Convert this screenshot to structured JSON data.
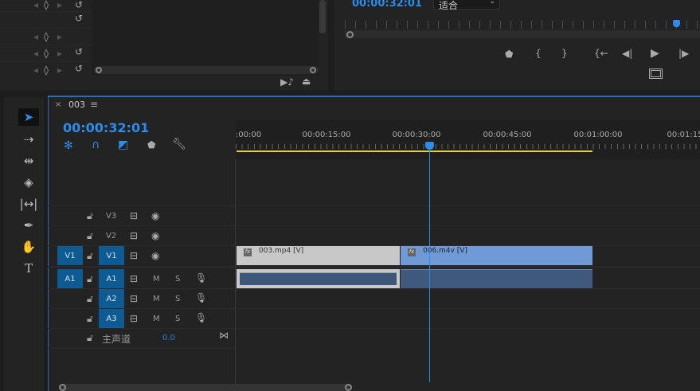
{
  "effect_controls": {
    "rows": [
      {
        "reset": true
      },
      {
        "reset": true
      },
      {
        "reset": false
      },
      {
        "reset": true
      },
      {
        "reset": true
      }
    ]
  },
  "program_monitor": {
    "timecode": "00:00:32:01",
    "fit_select": "适合",
    "playhead_fraction": 0.94,
    "controls": [
      "marker-icon",
      "mark-in-icon",
      "mark-out-icon",
      "go-to-in-icon",
      "step-back-icon",
      "play-icon",
      "step-forward-icon"
    ]
  },
  "timeline": {
    "sequence_name": "003",
    "timecode": "00:00:32:01",
    "ruler_labels": [
      ":00:00",
      "00:00:15:00",
      "00:00:30:00",
      "00:00:45:00",
      "00:01:00:00",
      "00:01:15"
    ],
    "video_tracks": [
      {
        "name": "V3",
        "source": ""
      },
      {
        "name": "V2",
        "source": ""
      },
      {
        "name": "V1",
        "source": "V1"
      }
    ],
    "audio_tracks": [
      {
        "name": "A1",
        "source": "A1",
        "m": "M",
        "s": "S"
      },
      {
        "name": "A2",
        "source": "",
        "m": "M",
        "s": "S"
      },
      {
        "name": "A3",
        "source": "",
        "m": "M",
        "s": "S"
      }
    ],
    "master": {
      "label": "主声道",
      "value": "0.0"
    },
    "clips": [
      {
        "name": "003.mp4 [V]",
        "fx": "fx"
      },
      {
        "name": "006.m4v [V]",
        "fx": "fx"
      }
    ],
    "accent": "#2d8ceb",
    "clip_grey": "#c8c8c8",
    "clip_blue": "#6f9ad5"
  }
}
